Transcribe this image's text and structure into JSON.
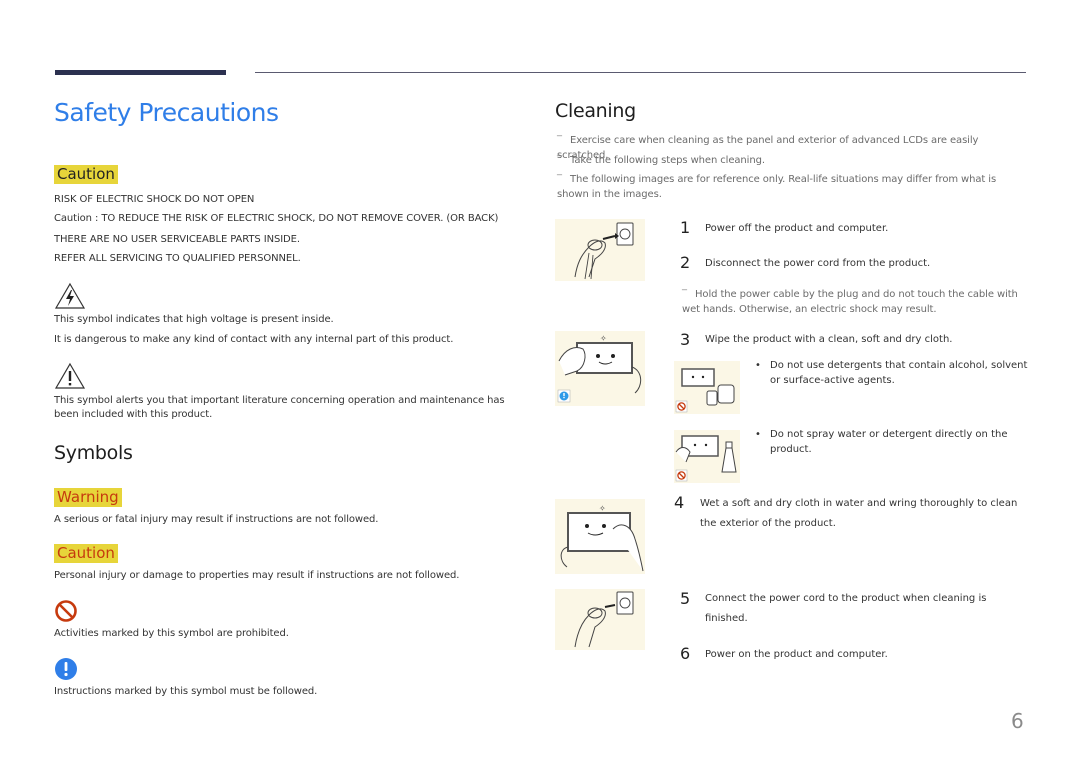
{
  "page": {
    "number": "6",
    "accent_color": "#2f7ee8",
    "highlight_color": "#e7d53a",
    "warning_text_color": "#c63a0e"
  },
  "left": {
    "title": "Safety Precautions",
    "caution_block": {
      "badge": "Caution",
      "lines": [
        "RISK OF ELECTRIC SHOCK DO NOT OPEN",
        "Caution : TO REDUCE THE RISK OF ELECTRIC SHOCK, DO NOT REMOVE COVER. (OR BACK)",
        "THERE ARE NO USER SERVICEABLE PARTS INSIDE.",
        "REFER ALL SERVICING TO QUALIFIED PERSONNEL."
      ],
      "symbols": [
        {
          "icon": "high-voltage-triangle-icon",
          "lines": [
            "This symbol indicates that high voltage is present inside.",
            "It is dangerous to make any kind of contact with any internal part of this product."
          ]
        },
        {
          "icon": "exclamation-triangle-icon",
          "lines": [
            "This symbol alerts you that important literature concerning operation and maintenance has been included with this product."
          ]
        }
      ]
    },
    "symbols_section": {
      "heading": "Symbols",
      "items": [
        {
          "badge": "Warning",
          "text": "A serious or fatal injury may result if instructions are not followed."
        },
        {
          "badge": "Caution",
          "text": "Personal injury or damage to properties may result if instructions are not followed."
        },
        {
          "icon": "prohibited-icon",
          "text": "Activities marked by this symbol are prohibited."
        },
        {
          "icon": "mandatory-exclamation-icon",
          "text": "Instructions marked by this symbol must be followed."
        }
      ]
    }
  },
  "right": {
    "heading": "Cleaning",
    "notes": [
      "Exercise care when cleaning as the panel and exterior of advanced LCDs are easily scratched.",
      "Take the following steps when cleaning.",
      "The following images are for reference only. Real-life situations may differ from what is shown in the images."
    ],
    "steps": [
      {
        "num": "1",
        "text": "Power off the product and computer."
      },
      {
        "num": "2",
        "text": "Disconnect the power cord from the product."
      },
      {
        "num": "3",
        "text": "Wipe the product with a clean, soft and dry cloth."
      },
      {
        "num": "4",
        "text": "Wet a soft and dry cloth in water and wring thoroughly to clean the exterior of the product."
      },
      {
        "num": "5",
        "text": "Connect the power cord to the product when cleaning is finished."
      },
      {
        "num": "6",
        "text": "Power on the product and computer."
      }
    ],
    "step2_note": "Hold the power cable by the plug and do not touch the cable with wet hands. Otherwise, an electric shock may result.",
    "step3_bullets": [
      "Do not use detergents that contain alcohol, solvent or surface-active agents.",
      "Do not spray water or detergent directly on the product."
    ],
    "illustrations": [
      "unplug-power-cord-illustration",
      "wipe-screen-dry-cloth-illustration",
      "no-detergent-illustration",
      "no-spray-illustration",
      "wipe-with-damp-cloth-illustration",
      "plug-in-power-cord-illustration"
    ]
  }
}
